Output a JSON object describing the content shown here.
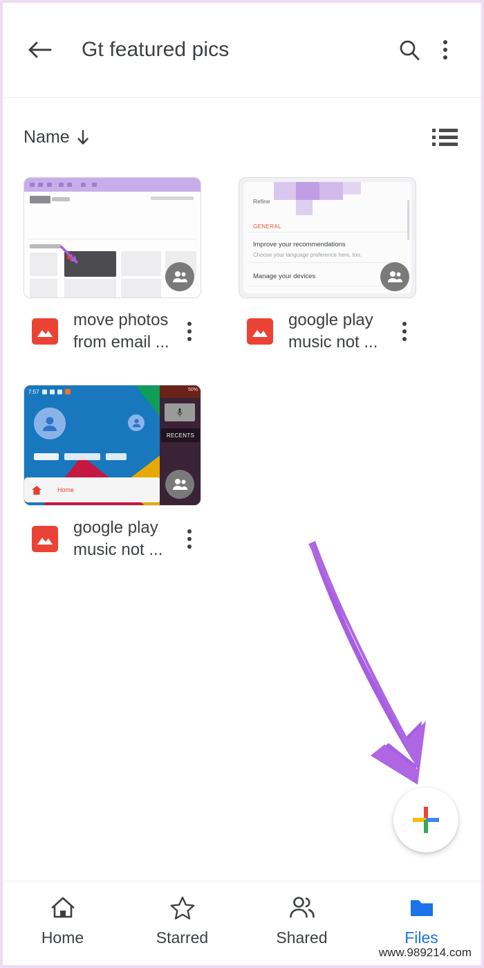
{
  "app": {
    "title": "Gt featured pics",
    "back_icon": "arrow-left-icon",
    "search_icon": "search-icon",
    "overflow_icon": "more-vertical-icon"
  },
  "sortbar": {
    "label": "Name",
    "direction_icon": "arrow-down-icon",
    "view_toggle_icon": "list-view-icon"
  },
  "files": [
    {
      "name": "move photos from email ...",
      "icon": "image-file-icon",
      "menu_icon": "more-vertical-icon",
      "shared_badge_icon": "people-icon",
      "thumbnail": "browser-window-screenshot"
    },
    {
      "name": "google play music not ...",
      "icon": "image-file-icon",
      "menu_icon": "more-vertical-icon",
      "shared_badge_icon": "people-icon",
      "thumbnail": "settings-list-screenshot",
      "thumb_text": {
        "refine": "Refine",
        "general": "GENERAL",
        "improve_title": "Improve your recommendations",
        "improve_sub": "Choose your language preference here, too.",
        "manage": "Manage your devices"
      }
    },
    {
      "name": "google play music not ...",
      "icon": "image-file-icon",
      "menu_icon": "more-vertical-icon",
      "shared_badge_icon": "people-icon",
      "thumbnail": "colorful-mobile-screenshot",
      "thumb_text": {
        "time": "7:57",
        "battery": "50%",
        "home": "Home",
        "recents": "RECENTS"
      }
    }
  ],
  "fab": {
    "icon": "google-plus-add-icon",
    "colors": {
      "red": "#ea4335",
      "yellow": "#fbbc04",
      "blue": "#4285f4",
      "green": "#34a853"
    }
  },
  "annotation": {
    "arrow_color": "#a75ee0",
    "icon": "annotation-arrow-icon"
  },
  "bottom_nav": {
    "items": [
      {
        "label": "Home",
        "icon": "home-icon",
        "active": false
      },
      {
        "label": "Starred",
        "icon": "star-icon",
        "active": false
      },
      {
        "label": "Shared",
        "icon": "people-icon",
        "active": false
      },
      {
        "label": "Files",
        "icon": "folder-icon",
        "active": true
      }
    ],
    "active_color": "#1a73e8"
  },
  "watermark": "www.989214.com"
}
